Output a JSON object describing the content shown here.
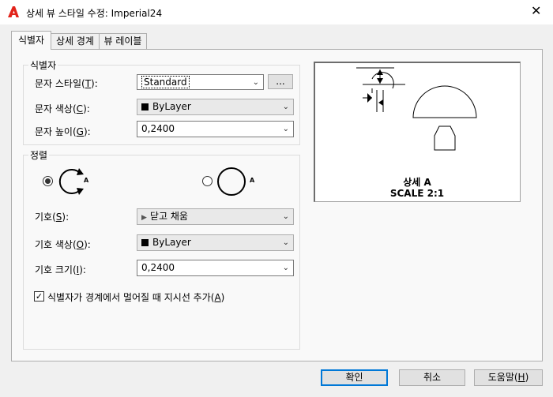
{
  "window": {
    "title": "상세 뷰 스타일 수정: Imperial24",
    "close_label": "✕",
    "accent_color": "#e2231a"
  },
  "tabs": [
    {
      "label": "식별자"
    },
    {
      "label": "상세 경계"
    },
    {
      "label": "뷰 레이블"
    }
  ],
  "identifier": {
    "group_label": "식별자",
    "text_style_label": "문자 스타일(T):",
    "text_style_value": "Standard",
    "browse_label": "...",
    "text_color_label": "문자 색상(C):",
    "text_color_value": "ByLayer",
    "text_height_label": "문자 높이(G):",
    "text_height_value": "0,2400"
  },
  "arrangement": {
    "group_label": "정렬",
    "symbol_label": "기호(S):",
    "symbol_value": "닫고 채움",
    "symbol_color_label": "기호 색상(O):",
    "symbol_color_value": "ByLayer",
    "symbol_size_label": "기호 크기(I):",
    "symbol_size_value": "0,2400",
    "option_letter": "A",
    "leader_checkbox_label": "식별자가 경계에서 멀어질 때 지시선 추가(A)",
    "leader_checked": true
  },
  "preview": {
    "detail_label": "상세 A",
    "scale_label": "SCALE 2:1"
  },
  "buttons": {
    "ok": "확인",
    "cancel": "취소",
    "help": "도움말(H)"
  }
}
